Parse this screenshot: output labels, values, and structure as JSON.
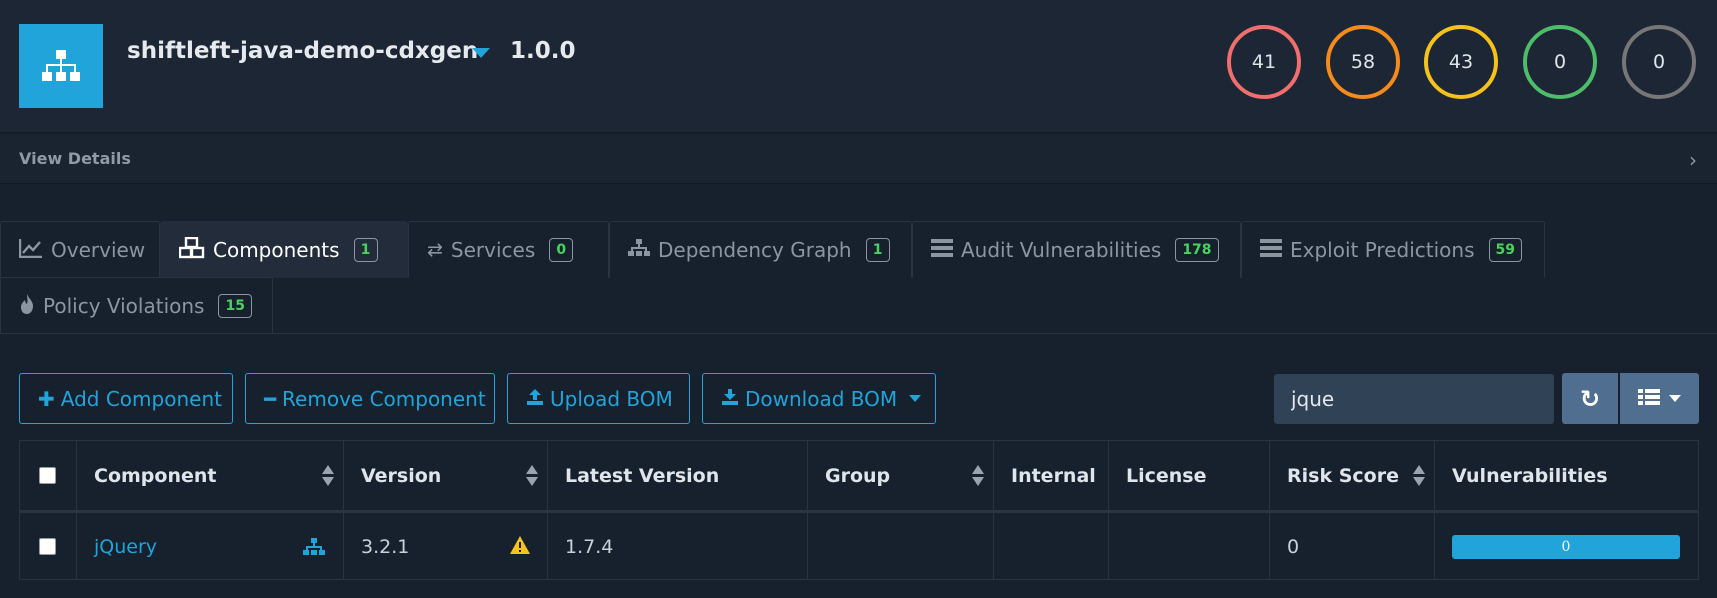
{
  "project": {
    "name": "shiftleft-java-demo-cdxgen",
    "version": "1.0.0"
  },
  "severity": [
    {
      "name": "critical",
      "count": "41",
      "color": "#f06e6e"
    },
    {
      "name": "high",
      "count": "58",
      "color": "#f58b1b"
    },
    {
      "name": "medium",
      "count": "43",
      "color": "#f5c21b"
    },
    {
      "name": "low",
      "count": "0",
      "color": "#4dbd6a"
    },
    {
      "name": "unassigned",
      "count": "0",
      "color": "#777777"
    }
  ],
  "details": {
    "label": "View Details"
  },
  "tabs": [
    {
      "label": "Overview",
      "icon": "chart-line-icon",
      "badge": ""
    },
    {
      "label": "Components",
      "icon": "cubes-icon",
      "badge": "1"
    },
    {
      "label": "Services",
      "icon": "exchange-icon",
      "badge": "0"
    },
    {
      "label": "Dependency Graph",
      "icon": "sitemap-icon",
      "badge": "1"
    },
    {
      "label": "Audit Vulnerabilities",
      "icon": "tasks-icon",
      "badge": "178"
    },
    {
      "label": "Exploit Predictions",
      "icon": "tasks-icon",
      "badge": "59"
    },
    {
      "label": "Policy Violations",
      "icon": "fire-icon",
      "badge": "15"
    }
  ],
  "toolbar": {
    "add": "Add Component",
    "remove": "Remove Component",
    "upload": "Upload BOM",
    "download": "Download BOM",
    "search_value": "jque"
  },
  "table": {
    "columns": [
      "Component",
      "Version",
      "Latest Version",
      "Group",
      "Internal",
      "License",
      "Risk Score",
      "Vulnerabilities"
    ],
    "rows": [
      {
        "component": "jQuery",
        "version": "3.2.1",
        "latest_version": "1.7.4",
        "group": "",
        "internal": "",
        "license": "",
        "risk_score": "0",
        "vulnerabilities": "0"
      }
    ]
  },
  "colors": {
    "accent": "#21a4da",
    "badge_text": "#4bd15d",
    "warning": "#f5c21b"
  }
}
